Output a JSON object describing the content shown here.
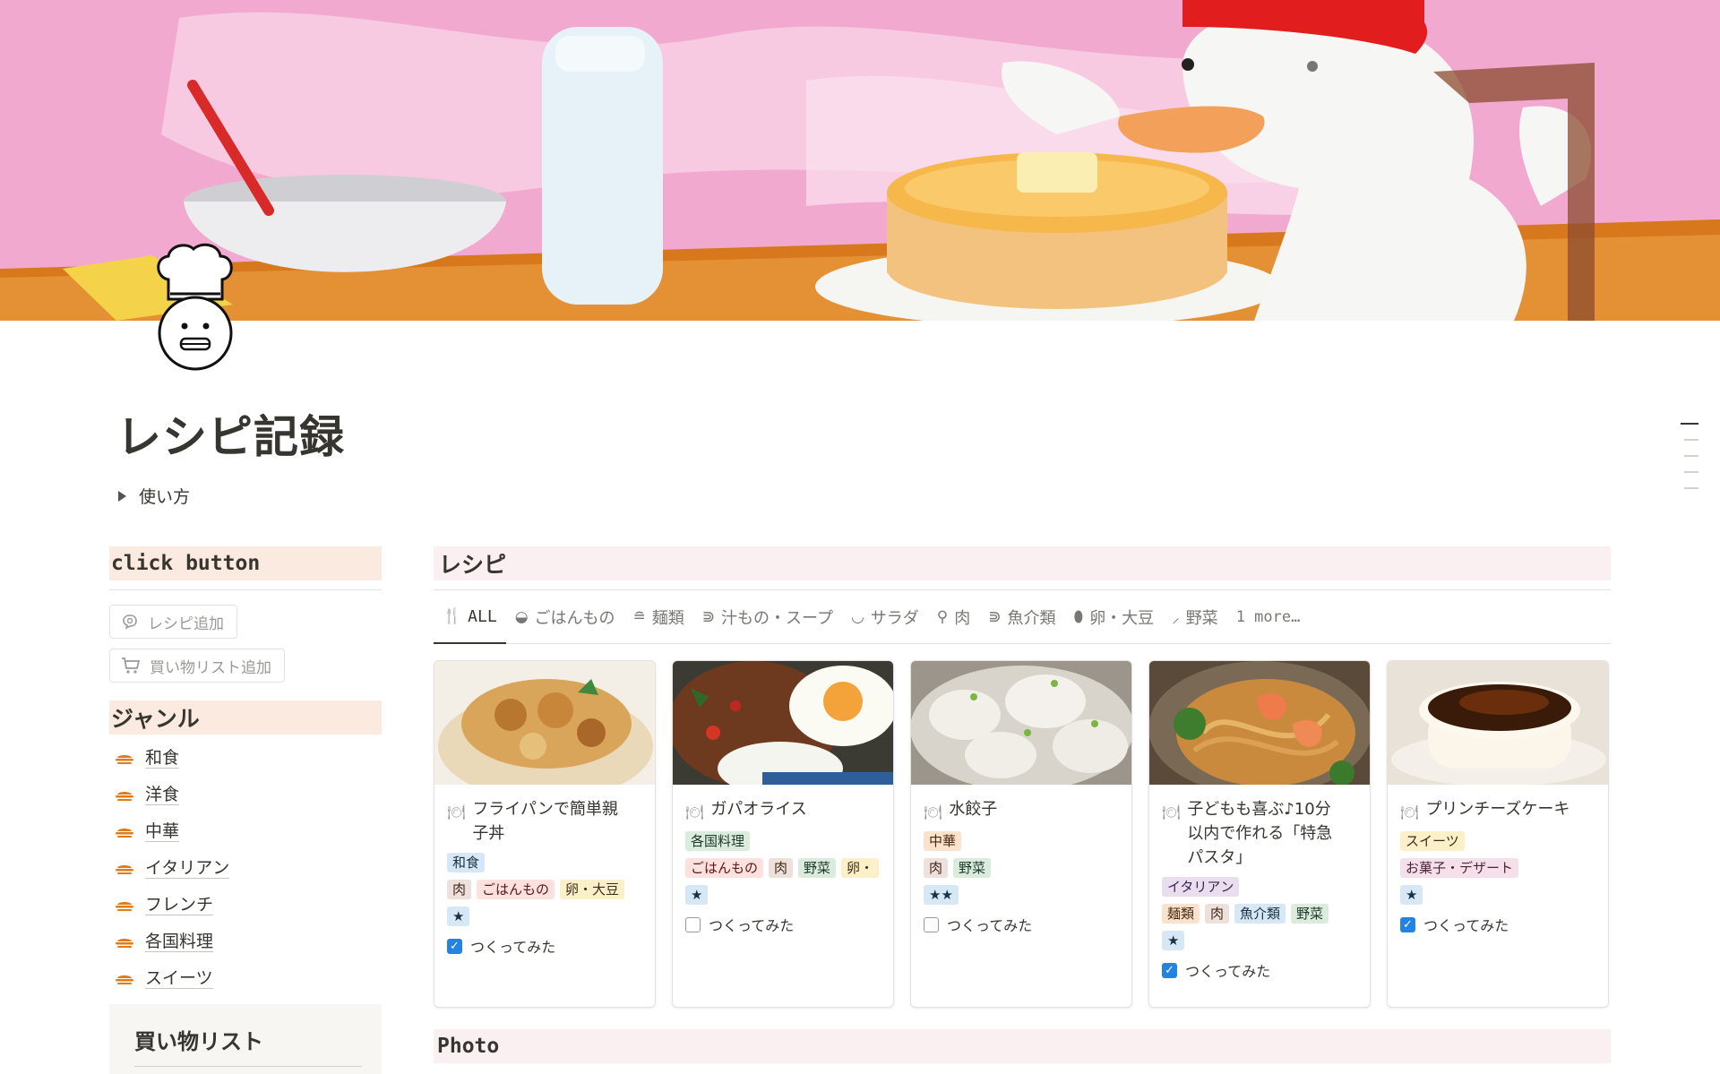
{
  "page": {
    "title": "レシピ記録",
    "toggle_label": "使い方"
  },
  "left": {
    "click_button_heading": "click button",
    "buttons": [
      {
        "label": "レシピ追加",
        "icon": "chat-search-icon"
      },
      {
        "label": "買い物リスト追加",
        "icon": "cart-icon"
      }
    ],
    "genre_heading": "ジャンル",
    "genres": [
      "和食",
      "洋食",
      "中華",
      "イタリアン",
      "フレンチ",
      "各国料理",
      "スイーツ"
    ],
    "shopping_heading": "買い物リスト"
  },
  "recipes": {
    "heading": "レシピ",
    "tabs": [
      {
        "label": "ALL",
        "icon": "fork-knife-icon",
        "glyph": "🍴",
        "active": true
      },
      {
        "label": "ごはんもの",
        "icon": "rice-bowl-icon",
        "glyph": "◒"
      },
      {
        "label": "麺類",
        "icon": "noodle-icon",
        "glyph": "≘"
      },
      {
        "label": "汁もの・スープ",
        "icon": "fish-icon",
        "glyph": "⋑"
      },
      {
        "label": "サラダ",
        "icon": "salad-bowl-icon",
        "glyph": "◡"
      },
      {
        "label": "肉",
        "icon": "meat-icon",
        "glyph": "⚲"
      },
      {
        "label": "魚介類",
        "icon": "fish-icon",
        "glyph": "⋑"
      },
      {
        "label": "卵・大豆",
        "icon": "egg-icon",
        "glyph": "⬮"
      },
      {
        "label": "野菜",
        "icon": "carrot-icon",
        "glyph": "⸝"
      },
      {
        "label": "1 more…",
        "icon": "",
        "glyph": "",
        "more": true
      }
    ],
    "cards": [
      {
        "title": "フライパンで簡単親子丼",
        "title_lines": [
          "フライパンで簡単親",
          "子丼"
        ],
        "genre_tags": [
          {
            "label": "和食",
            "color": "blue"
          }
        ],
        "category_tags": [
          {
            "label": "肉",
            "color": "brown"
          },
          {
            "label": "ごはんもの",
            "color": "red"
          },
          {
            "label": "卵・大豆",
            "color": "yellow"
          }
        ],
        "rating": "★",
        "made_label": "つくってみた",
        "made": true,
        "thumb": "oyakodon"
      },
      {
        "title": "ガパオライス",
        "title_lines": [
          "ガパオライス"
        ],
        "genre_tags": [
          {
            "label": "各国料理",
            "color": "green"
          }
        ],
        "category_tags": [
          {
            "label": "ごはんもの",
            "color": "red"
          },
          {
            "label": "肉",
            "color": "brown"
          },
          {
            "label": "野菜",
            "color": "green"
          },
          {
            "label": "卵・",
            "color": "yellow"
          }
        ],
        "rating": "★",
        "made_label": "つくってみた",
        "made": false,
        "thumb": "gapao"
      },
      {
        "title": "水餃子",
        "title_lines": [
          "水餃子"
        ],
        "genre_tags": [
          {
            "label": "中華",
            "color": "orange"
          }
        ],
        "category_tags": [
          {
            "label": "肉",
            "color": "brown"
          },
          {
            "label": "野菜",
            "color": "green"
          }
        ],
        "rating": "★★",
        "made_label": "つくってみた",
        "made": false,
        "thumb": "gyoza"
      },
      {
        "title": "子どもも喜ぶ♪10分以内で作れる「特急パスタ」",
        "title_lines": [
          "子どもも喜ぶ♪10分",
          "以内で作れる「特急",
          "パスタ」"
        ],
        "genre_tags": [
          {
            "label": "イタリアン",
            "color": "purple"
          }
        ],
        "category_tags": [
          {
            "label": "麺類",
            "color": "orange"
          },
          {
            "label": "肉",
            "color": "brown"
          },
          {
            "label": "魚介類",
            "color": "blue"
          },
          {
            "label": "野菜",
            "color": "green"
          }
        ],
        "rating": "★",
        "made_label": "つくってみた",
        "made": true,
        "thumb": "pasta"
      },
      {
        "title": "プリンチーズケーキ",
        "title_lines": [
          "プリンチーズケーキ"
        ],
        "genre_tags": [
          {
            "label": "スイーツ",
            "color": "yellow"
          }
        ],
        "category_tags": [
          {
            "label": "お菓子・デザート",
            "color": "pink"
          }
        ],
        "rating": "★",
        "made_label": "つくってみた",
        "made": true,
        "thumb": "pudding"
      }
    ]
  },
  "photo_heading": "Photo",
  "colors": {
    "cover_pink": "#f2a9cf",
    "section_peach": "#fbeadf",
    "section_pink": "#fbf0f1",
    "checkbox_blue": "#2383e2",
    "genre_icon_orange": "#e07b1a"
  }
}
